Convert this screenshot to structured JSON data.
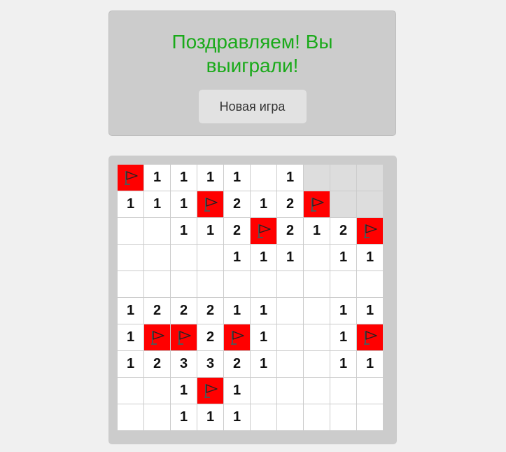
{
  "status": {
    "message": "Поздравляем! Вы выиграли!",
    "new_game_label": "Новая игра",
    "message_color": "#1aaa1a"
  },
  "board": {
    "rows": 10,
    "cols": 10,
    "flag_color": "#ff0000",
    "hidden_color": "#dddddd",
    "flag_icon": "flag-icon",
    "cells": [
      [
        "F",
        "1",
        "1",
        "1",
        "1",
        "",
        "1",
        "H",
        "H",
        "H"
      ],
      [
        "1",
        "1",
        "1",
        "F",
        "2",
        "1",
        "2",
        "F",
        "H",
        "H"
      ],
      [
        "",
        "",
        "1",
        "1",
        "2",
        "F",
        "2",
        "1",
        "2",
        "F"
      ],
      [
        "",
        "",
        "",
        "",
        "1",
        "1",
        "1",
        "",
        "1",
        "1"
      ],
      [
        "",
        "",
        "",
        "",
        "",
        "",
        "",
        "",
        "",
        ""
      ],
      [
        "1",
        "2",
        "2",
        "2",
        "1",
        "1",
        "",
        "",
        "1",
        "1"
      ],
      [
        "1",
        "F",
        "F",
        "2",
        "F",
        "1",
        "",
        "",
        "1",
        "F"
      ],
      [
        "1",
        "2",
        "3",
        "3",
        "2",
        "1",
        "",
        "",
        "1",
        "1"
      ],
      [
        "",
        "",
        "1",
        "F",
        "1",
        "",
        "",
        "",
        "",
        ""
      ],
      [
        "",
        "",
        "1",
        "1",
        "1",
        "",
        "",
        "",
        "",
        ""
      ]
    ]
  }
}
